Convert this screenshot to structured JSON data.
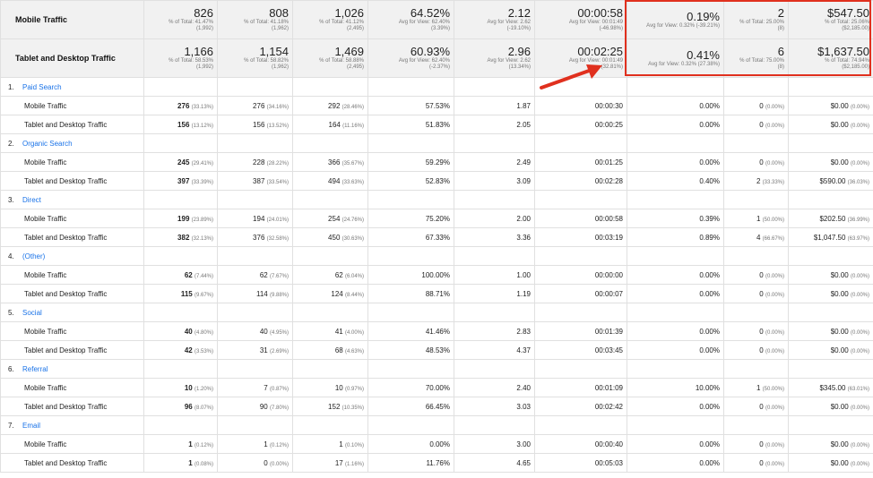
{
  "segments": [
    {
      "name": "Mobile Traffic",
      "cells": [
        {
          "big": "826",
          "sub1": "% of Total: 41.47%",
          "sub2": "(1,992)"
        },
        {
          "big": "808",
          "sub1": "% of Total: 41.18%",
          "sub2": "(1,962)"
        },
        {
          "big": "1,026",
          "sub1": "% of Total: 41.12%",
          "sub2": "(2,495)"
        },
        {
          "big": "64.52%",
          "sub1": "Avg for View: 62.40%",
          "sub2": "(3.39%)"
        },
        {
          "big": "2.12",
          "sub1": "Avg for View: 2.62",
          "sub2": "(-19.10%)"
        },
        {
          "big": "00:00:58",
          "sub1": "Avg for View: 00:01:49",
          "sub2": "(-46.98%)"
        },
        {
          "big": "0.19%",
          "sub1": "Avg for View: 0.32% (-39.21%)",
          "sub2": ""
        },
        {
          "big": "2",
          "sub1": "% of Total: 25.00%",
          "sub2": "(8)"
        },
        {
          "big": "$547.50",
          "sub1": "% of Total: 25.06%",
          "sub2": "($2,185.00)"
        }
      ]
    },
    {
      "name": "Tablet and Desktop Traffic",
      "cells": [
        {
          "big": "1,166",
          "sub1": "% of Total: 58.53%",
          "sub2": "(1,992)"
        },
        {
          "big": "1,154",
          "sub1": "% of Total: 58.82%",
          "sub2": "(1,962)"
        },
        {
          "big": "1,469",
          "sub1": "% of Total: 58.88%",
          "sub2": "(2,495)"
        },
        {
          "big": "60.93%",
          "sub1": "Avg for View: 62.40%",
          "sub2": "(-2.37%)"
        },
        {
          "big": "2.96",
          "sub1": "Avg for View: 2.62",
          "sub2": "(13.34%)"
        },
        {
          "big": "00:02:25",
          "sub1": "Avg for View: 00:01:49",
          "sub2": "(32.81%)"
        },
        {
          "big": "0.41%",
          "sub1": "Avg for View: 0.32% (27.38%)",
          "sub2": ""
        },
        {
          "big": "6",
          "sub1": "% of Total: 75.00%",
          "sub2": "(8)"
        },
        {
          "big": "$1,637.50",
          "sub1": "% of Total: 74.94%",
          "sub2": "($2,185.00)"
        }
      ]
    }
  ],
  "groups": [
    {
      "num": "1.",
      "name": "Paid Search",
      "rows": [
        {
          "name": "Mobile Traffic",
          "c1": "276",
          "c1p": "(33.13%)",
          "c2": "276",
          "c2p": "(34.16%)",
          "c3": "292",
          "c3p": "(28.46%)",
          "c4": "57.53%",
          "c5": "1.87",
          "c6": "00:00:30",
          "c7": "0.00%",
          "c8": "0",
          "c8p": "(0.00%)",
          "c9": "$0.00",
          "c9p": "(0.00%)"
        },
        {
          "name": "Tablet and Desktop Traffic",
          "c1": "156",
          "c1p": "(13.12%)",
          "c2": "156",
          "c2p": "(13.52%)",
          "c3": "164",
          "c3p": "(11.16%)",
          "c4": "51.83%",
          "c5": "2.05",
          "c6": "00:00:25",
          "c7": "0.00%",
          "c8": "0",
          "c8p": "(0.00%)",
          "c9": "$0.00",
          "c9p": "(0.00%)"
        }
      ]
    },
    {
      "num": "2.",
      "name": "Organic Search",
      "rows": [
        {
          "name": "Mobile Traffic",
          "c1": "245",
          "c1p": "(29.41%)",
          "c2": "228",
          "c2p": "(28.22%)",
          "c3": "366",
          "c3p": "(35.67%)",
          "c4": "59.29%",
          "c5": "2.49",
          "c6": "00:01:25",
          "c7": "0.00%",
          "c8": "0",
          "c8p": "(0.00%)",
          "c9": "$0.00",
          "c9p": "(0.00%)"
        },
        {
          "name": "Tablet and Desktop Traffic",
          "c1": "397",
          "c1p": "(33.39%)",
          "c2": "387",
          "c2p": "(33.54%)",
          "c3": "494",
          "c3p": "(33.63%)",
          "c4": "52.83%",
          "c5": "3.09",
          "c6": "00:02:28",
          "c7": "0.40%",
          "c8": "2",
          "c8p": "(33.33%)",
          "c9": "$590.00",
          "c9p": "(36.03%)"
        }
      ]
    },
    {
      "num": "3.",
      "name": "Direct",
      "rows": [
        {
          "name": "Mobile Traffic",
          "c1": "199",
          "c1p": "(23.89%)",
          "c2": "194",
          "c2p": "(24.01%)",
          "c3": "254",
          "c3p": "(24.76%)",
          "c4": "75.20%",
          "c5": "2.00",
          "c6": "00:00:58",
          "c7": "0.39%",
          "c8": "1",
          "c8p": "(50.00%)",
          "c9": "$202.50",
          "c9p": "(36.99%)"
        },
        {
          "name": "Tablet and Desktop Traffic",
          "c1": "382",
          "c1p": "(32.13%)",
          "c2": "376",
          "c2p": "(32.58%)",
          "c3": "450",
          "c3p": "(30.63%)",
          "c4": "67.33%",
          "c5": "3.36",
          "c6": "00:03:19",
          "c7": "0.89%",
          "c8": "4",
          "c8p": "(66.67%)",
          "c9": "$1,047.50",
          "c9p": "(63.97%)"
        }
      ]
    },
    {
      "num": "4.",
      "name": "(Other)",
      "rows": [
        {
          "name": "Mobile Traffic",
          "c1": "62",
          "c1p": "(7.44%)",
          "c2": "62",
          "c2p": "(7.67%)",
          "c3": "62",
          "c3p": "(6.04%)",
          "c4": "100.00%",
          "c5": "1.00",
          "c6": "00:00:00",
          "c7": "0.00%",
          "c8": "0",
          "c8p": "(0.00%)",
          "c9": "$0.00",
          "c9p": "(0.00%)"
        },
        {
          "name": "Tablet and Desktop Traffic",
          "c1": "115",
          "c1p": "(9.67%)",
          "c2": "114",
          "c2p": "(9.88%)",
          "c3": "124",
          "c3p": "(8.44%)",
          "c4": "88.71%",
          "c5": "1.19",
          "c6": "00:00:07",
          "c7": "0.00%",
          "c8": "0",
          "c8p": "(0.00%)",
          "c9": "$0.00",
          "c9p": "(0.00%)"
        }
      ]
    },
    {
      "num": "5.",
      "name": "Social",
      "rows": [
        {
          "name": "Mobile Traffic",
          "c1": "40",
          "c1p": "(4.80%)",
          "c2": "40",
          "c2p": "(4.95%)",
          "c3": "41",
          "c3p": "(4.00%)",
          "c4": "41.46%",
          "c5": "2.83",
          "c6": "00:01:39",
          "c7": "0.00%",
          "c8": "0",
          "c8p": "(0.00%)",
          "c9": "$0.00",
          "c9p": "(0.00%)"
        },
        {
          "name": "Tablet and Desktop Traffic",
          "c1": "42",
          "c1p": "(3.53%)",
          "c2": "31",
          "c2p": "(2.69%)",
          "c3": "68",
          "c3p": "(4.63%)",
          "c4": "48.53%",
          "c5": "4.37",
          "c6": "00:03:45",
          "c7": "0.00%",
          "c8": "0",
          "c8p": "(0.00%)",
          "c9": "$0.00",
          "c9p": "(0.00%)"
        }
      ]
    },
    {
      "num": "6.",
      "name": "Referral",
      "rows": [
        {
          "name": "Mobile Traffic",
          "c1": "10",
          "c1p": "(1.20%)",
          "c2": "7",
          "c2p": "(0.87%)",
          "c3": "10",
          "c3p": "(0.97%)",
          "c4": "70.00%",
          "c5": "2.40",
          "c6": "00:01:09",
          "c7": "10.00%",
          "c8": "1",
          "c8p": "(50.00%)",
          "c9": "$345.00",
          "c9p": "(63.01%)"
        },
        {
          "name": "Tablet and Desktop Traffic",
          "c1": "96",
          "c1p": "(8.07%)",
          "c2": "90",
          "c2p": "(7.80%)",
          "c3": "152",
          "c3p": "(10.35%)",
          "c4": "66.45%",
          "c5": "3.03",
          "c6": "00:02:42",
          "c7": "0.00%",
          "c8": "0",
          "c8p": "(0.00%)",
          "c9": "$0.00",
          "c9p": "(0.00%)"
        }
      ]
    },
    {
      "num": "7.",
      "name": "Email",
      "rows": [
        {
          "name": "Mobile Traffic",
          "c1": "1",
          "c1p": "(0.12%)",
          "c2": "1",
          "c2p": "(0.12%)",
          "c3": "1",
          "c3p": "(0.10%)",
          "c4": "0.00%",
          "c5": "3.00",
          "c6": "00:00:40",
          "c7": "0.00%",
          "c8": "0",
          "c8p": "(0.00%)",
          "c9": "$0.00",
          "c9p": "(0.00%)"
        },
        {
          "name": "Tablet and Desktop Traffic",
          "c1": "1",
          "c1p": "(0.08%)",
          "c2": "0",
          "c2p": "(0.00%)",
          "c3": "17",
          "c3p": "(1.16%)",
          "c4": "11.76%",
          "c5": "4.65",
          "c6": "00:05:03",
          "c7": "0.00%",
          "c8": "0",
          "c8p": "(0.00%)",
          "c9": "$0.00",
          "c9p": "(0.00%)"
        }
      ]
    }
  ],
  "colors": {
    "highlight": "#e0301e",
    "link": "#1a73e8",
    "arrow": "#e0301e"
  }
}
